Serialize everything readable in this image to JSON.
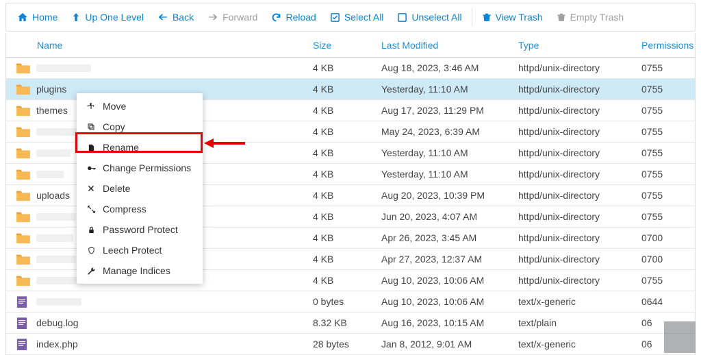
{
  "toolbar": {
    "home": "Home",
    "up": "Up One Level",
    "back": "Back",
    "forward": "Forward",
    "reload": "Reload",
    "select_all": "Select All",
    "unselect_all": "Unselect All",
    "view_trash": "View Trash",
    "empty_trash": "Empty Trash"
  },
  "columns": {
    "name": "Name",
    "size": "Size",
    "modified": "Last Modified",
    "type": "Type",
    "perms": "Permissions"
  },
  "context_menu": {
    "move": "Move",
    "copy": "Copy",
    "rename": "Rename",
    "change_perms": "Change Permissions",
    "delete": "Delete",
    "compress": "Compress",
    "password_protect": "Password Protect",
    "leech_protect": "Leech Protect",
    "manage_indices": "Manage Indices"
  },
  "rows": [
    {
      "name": "",
      "blur_w": 80,
      "icon": "folder",
      "size": "4 KB",
      "modified": "Aug 18, 2023, 3:46 AM",
      "type": "httpd/unix-directory",
      "perms": "0755",
      "selected": false
    },
    {
      "name": "plugins",
      "icon": "folder",
      "size": "4 KB",
      "modified": "Yesterday, 11:10 AM",
      "type": "httpd/unix-directory",
      "perms": "0755",
      "selected": true
    },
    {
      "name": "themes",
      "icon": "folder",
      "size": "4 KB",
      "modified": "Aug 17, 2023, 11:29 PM",
      "type": "httpd/unix-directory",
      "perms": "0755",
      "selected": false
    },
    {
      "name": "",
      "blur_w": 60,
      "icon": "folder",
      "size": "4 KB",
      "modified": "May 24, 2023, 6:39 AM",
      "type": "httpd/unix-directory",
      "perms": "0755",
      "selected": false
    },
    {
      "name": "",
      "blur_w": 50,
      "icon": "folder",
      "size": "4 KB",
      "modified": "Yesterday, 11:10 AM",
      "type": "httpd/unix-directory",
      "perms": "0755",
      "selected": false
    },
    {
      "name": "",
      "blur_w": 40,
      "icon": "folder",
      "size": "4 KB",
      "modified": "Yesterday, 11:10 AM",
      "type": "httpd/unix-directory",
      "perms": "0755",
      "selected": false
    },
    {
      "name": "uploads",
      "icon": "folder",
      "size": "4 KB",
      "modified": "Aug 20, 2023, 10:39 PM",
      "type": "httpd/unix-directory",
      "perms": "0755",
      "selected": false
    },
    {
      "name": "",
      "blur_w": 58,
      "icon": "folder",
      "size": "4 KB",
      "modified": "Jun 20, 2023, 4:07 AM",
      "type": "httpd/unix-directory",
      "perms": "0755",
      "selected": false
    },
    {
      "name": "",
      "blur_w": 54,
      "icon": "folder",
      "size": "4 KB",
      "modified": "Apr 26, 2023, 3:45 AM",
      "type": "httpd/unix-directory",
      "perms": "0700",
      "selected": false
    },
    {
      "name": "",
      "blur_w": 58,
      "icon": "folder",
      "size": "4 KB",
      "modified": "Apr 27, 2023, 12:37 AM",
      "type": "httpd/unix-directory",
      "perms": "0700",
      "selected": false
    },
    {
      "name": "",
      "blur_w": 70,
      "icon": "folder",
      "size": "4 KB",
      "modified": "Aug 10, 2023, 10:06 AM",
      "type": "httpd/unix-directory",
      "perms": "0755",
      "selected": false
    },
    {
      "name": "",
      "blur_w": 66,
      "icon": "file",
      "size": "0 bytes",
      "modified": "Aug 10, 2023, 10:06 AM",
      "type": "text/x-generic",
      "perms": "0644",
      "selected": false
    },
    {
      "name": "debug.log",
      "icon": "file",
      "size": "8.32 KB",
      "modified": "Aug 16, 2023, 10:15 AM",
      "type": "text/plain",
      "perms": "06",
      "selected": false
    },
    {
      "name": "index.php",
      "icon": "file",
      "size": "28 bytes",
      "modified": "Jan 8, 2012, 9:01 AM",
      "type": "text/x-generic",
      "perms": "06",
      "selected": false
    }
  ]
}
